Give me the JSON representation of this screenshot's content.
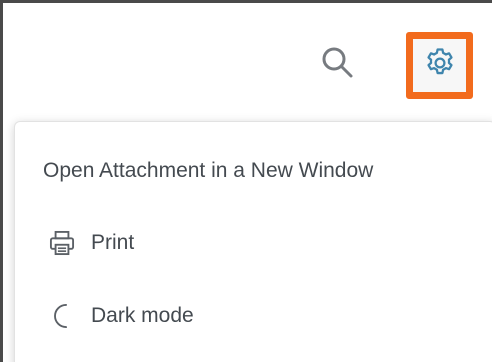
{
  "toolbar": {
    "search_icon": "search-icon",
    "settings_icon": "gear-icon",
    "highlight_color": "#f26b1d",
    "icon_color": "#4a8fb4"
  },
  "menu": {
    "items": [
      {
        "label": "Open Attachment in a New Window"
      },
      {
        "label": "Print",
        "icon": "printer-icon"
      },
      {
        "label": "Dark mode",
        "icon": "moon-icon"
      }
    ]
  }
}
